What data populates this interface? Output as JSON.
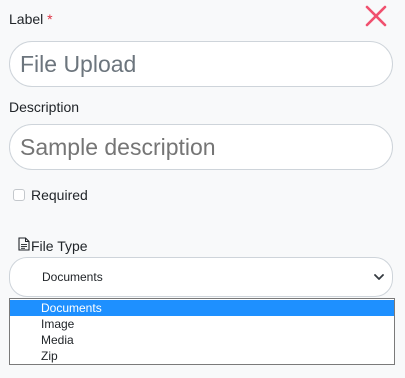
{
  "label_field": {
    "label": "Label",
    "required_mark": "*",
    "value": "File Upload"
  },
  "description_field": {
    "label": "Description",
    "placeholder": "Sample description"
  },
  "required_checkbox": {
    "label": "Required",
    "checked": false
  },
  "file_type": {
    "label": "File Type",
    "selected": "Documents",
    "options": [
      "Documents",
      "Image",
      "Media",
      "Zip"
    ]
  },
  "icons": {
    "close": "close-icon",
    "file": "file-icon",
    "chevron": "chevron-down-icon"
  },
  "colors": {
    "close_icon": "#f0506e",
    "required_mark": "#dc3545",
    "highlight": "#1e90ff"
  }
}
